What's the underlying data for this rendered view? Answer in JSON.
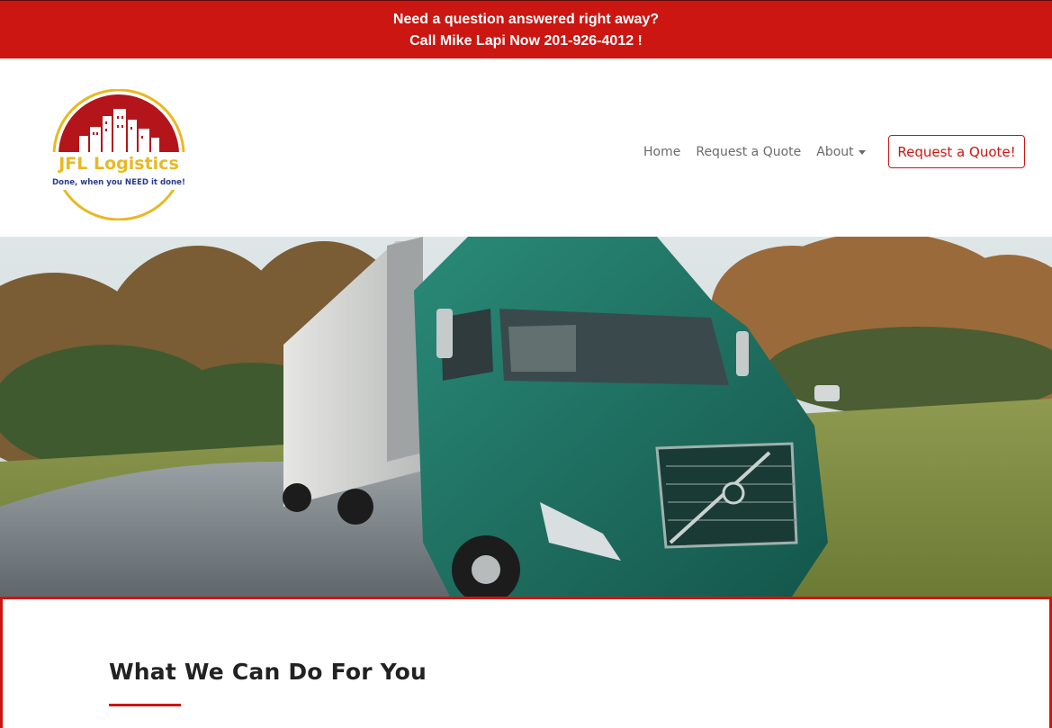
{
  "topbar": {
    "line1": "Need a question answered right away?",
    "line2": "Call Mike Lapi Now 201-926-4012 !"
  },
  "logo": {
    "name": "JFL Logistics",
    "tagline": "Done, when you NEED it done!"
  },
  "nav": {
    "items": [
      {
        "label": "Home"
      },
      {
        "label": "Request a Quote"
      },
      {
        "label": "About",
        "has_dropdown": true
      }
    ],
    "cta_label": "Request a Quote!"
  },
  "services": {
    "title": "What We Can Do For You"
  },
  "colors": {
    "brand_red": "#cc1611",
    "logo_gold": "#e8b923",
    "nav_text": "#6a6a6a",
    "truck_green": "#1d6b5e"
  }
}
